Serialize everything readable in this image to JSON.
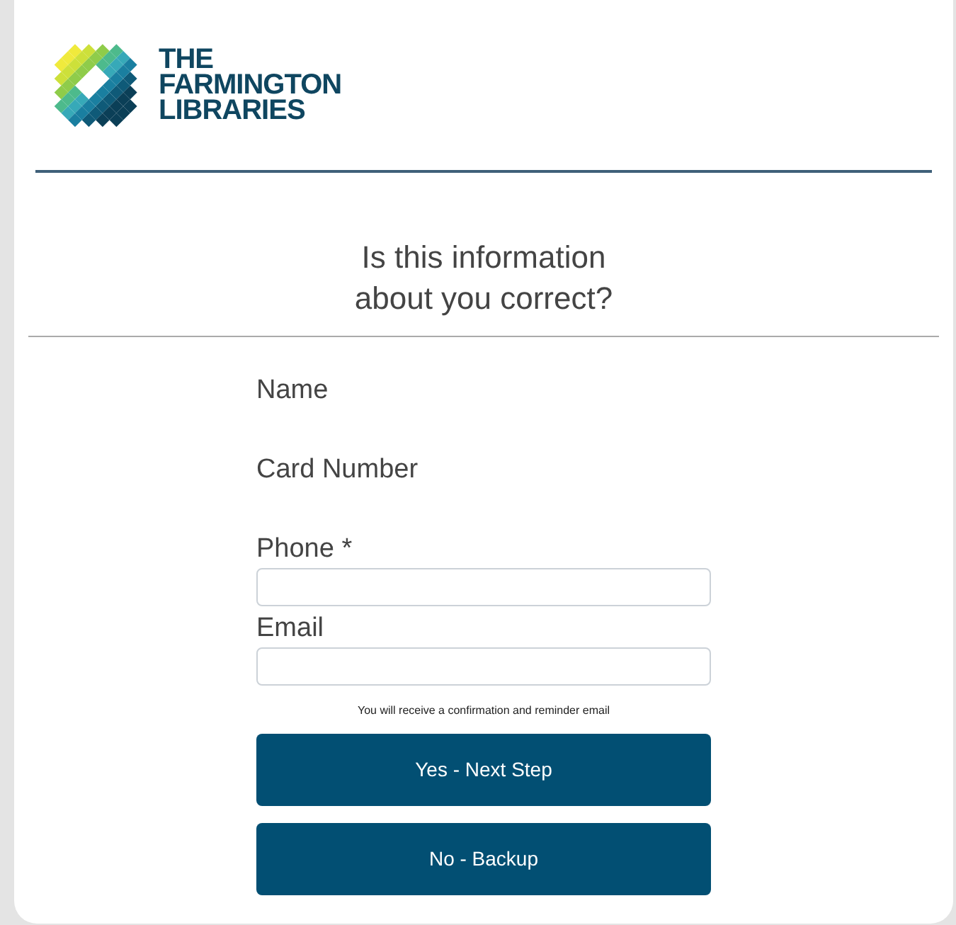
{
  "logo": {
    "lines": [
      "THE",
      "FARMINGTON",
      "LIBRARIES"
    ]
  },
  "heading": [
    "Is this information",
    "about you correct?"
  ],
  "fields": [
    {
      "kind": "info",
      "label": "Name"
    },
    {
      "kind": "info",
      "label": "Card Number"
    },
    {
      "kind": "input",
      "label": "Phone *"
    },
    {
      "kind": "input",
      "label": "Email"
    }
  ],
  "note": "You will receive a confirmation and reminder email",
  "buttons": [
    "Yes - Next Step",
    "No - Backup"
  ]
}
